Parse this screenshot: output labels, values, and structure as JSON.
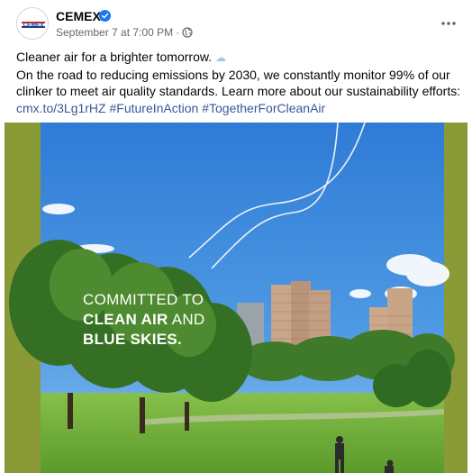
{
  "post": {
    "page_name": "CEMEX",
    "timestamp": "September 7 at 7:00 PM",
    "separator": "·",
    "logo_text": "CEMEX",
    "text_line1": "Cleaner air for a brighter tomorrow.",
    "text_line2": "On the road to reducing emissions by 2030, we constantly monitor 99% of our",
    "text_line3": "clinker to meet air quality standards. Learn more about our sustainability efforts:",
    "link": "cmx.to/3Lg1rHZ",
    "hashtag1": "#FutureInAction",
    "hashtag2": "#TogetherForCleanAir"
  },
  "image": {
    "headline_line1": "COMMITTED TO",
    "headline_line2_bold": "CLEAN AIR",
    "headline_line2_rest": " AND",
    "headline_line3_bold": "BLUE SKIES."
  },
  "colors": {
    "frame_green": "#8a9a37",
    "sky": "#3d86d8",
    "grass": "#6fae3a",
    "link_blue": "#385898",
    "verified_blue": "#1877f2"
  },
  "icons": {
    "verified": "verified-badge-icon",
    "globe": "globe-icon",
    "more": "more-options-icon",
    "cloud": "cloud-emoji"
  }
}
